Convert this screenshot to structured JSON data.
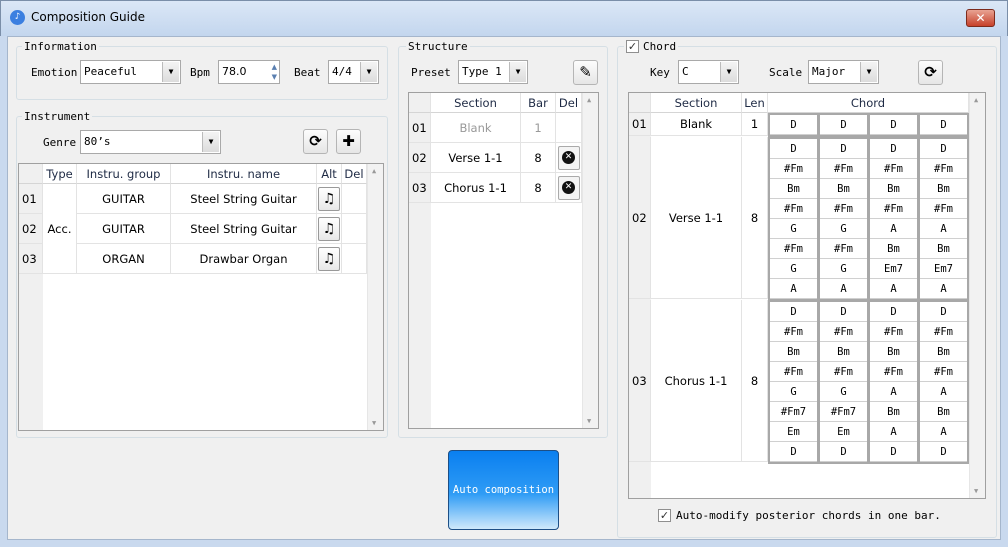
{
  "window": {
    "title": "Composition Guide",
    "close": "✕"
  },
  "information": {
    "label": "Information",
    "emotion_label": "Emotion",
    "emotion": "Peaceful",
    "bpm_label": "Bpm",
    "bpm": "78.0",
    "beat_label": "Beat",
    "beat": "4/4"
  },
  "instrument": {
    "label": "Instrument",
    "genre_label": "Genre",
    "genre": "80’s",
    "columns": [
      "Type",
      "Instru. group",
      "Instru. name",
      "Alt",
      "Del"
    ],
    "type_merged": "Acc.",
    "rows": [
      {
        "n": "01",
        "group": "GUITAR",
        "name": "Steel String Guitar"
      },
      {
        "n": "02",
        "group": "GUITAR",
        "name": "Steel String Guitar"
      },
      {
        "n": "03",
        "group": "ORGAN",
        "name": "Drawbar Organ"
      }
    ]
  },
  "structure": {
    "label": "Structure",
    "preset_label": "Preset",
    "preset": "Type 1",
    "columns": [
      "Section",
      "Bar",
      "Del"
    ],
    "rows": [
      {
        "n": "01",
        "section": "Blank",
        "bar": "1",
        "del": false
      },
      {
        "n": "02",
        "section": "Verse 1-1",
        "bar": "8",
        "del": true
      },
      {
        "n": "03",
        "section": "Chorus 1-1",
        "bar": "8",
        "del": true
      }
    ]
  },
  "chord": {
    "label": "Chord",
    "checked": true,
    "key_label": "Key",
    "key": "C",
    "scale_label": "Scale",
    "scale": "Major",
    "columns": [
      "Section",
      "Len",
      "Chord"
    ],
    "rows": [
      {
        "n": "01",
        "section": "Blank",
        "len": "1",
        "chords": [
          [
            "D",
            "D",
            "D",
            "D"
          ]
        ]
      },
      {
        "n": "02",
        "section": "Verse 1-1",
        "len": "8",
        "chords": [
          [
            "D",
            "D",
            "D",
            "D"
          ],
          [
            "#Fm",
            "#Fm",
            "#Fm",
            "#Fm"
          ],
          [
            "Bm",
            "Bm",
            "Bm",
            "Bm"
          ],
          [
            "#Fm",
            "#Fm",
            "#Fm",
            "#Fm"
          ],
          [
            "G",
            "G",
            "A",
            "A"
          ],
          [
            "#Fm",
            "#Fm",
            "Bm",
            "Bm"
          ],
          [
            "G",
            "G",
            "Em7",
            "Em7"
          ],
          [
            "A",
            "A",
            "A",
            "A"
          ]
        ]
      },
      {
        "n": "03",
        "section": "Chorus 1-1",
        "len": "8",
        "chords": [
          [
            "D",
            "D",
            "D",
            "D"
          ],
          [
            "#Fm",
            "#Fm",
            "#Fm",
            "#Fm"
          ],
          [
            "Bm",
            "Bm",
            "Bm",
            "Bm"
          ],
          [
            "#Fm",
            "#Fm",
            "#Fm",
            "#Fm"
          ],
          [
            "G",
            "G",
            "A",
            "A"
          ],
          [
            "#Fm7",
            "#Fm7",
            "Bm",
            "Bm"
          ],
          [
            "Em",
            "Em",
            "A",
            "A"
          ],
          [
            "D",
            "D",
            "D",
            "D"
          ]
        ]
      }
    ],
    "auto_modify_label": "Auto-modify posterior chords in one bar.",
    "auto_modify": true
  },
  "auto_button": "Auto composition"
}
